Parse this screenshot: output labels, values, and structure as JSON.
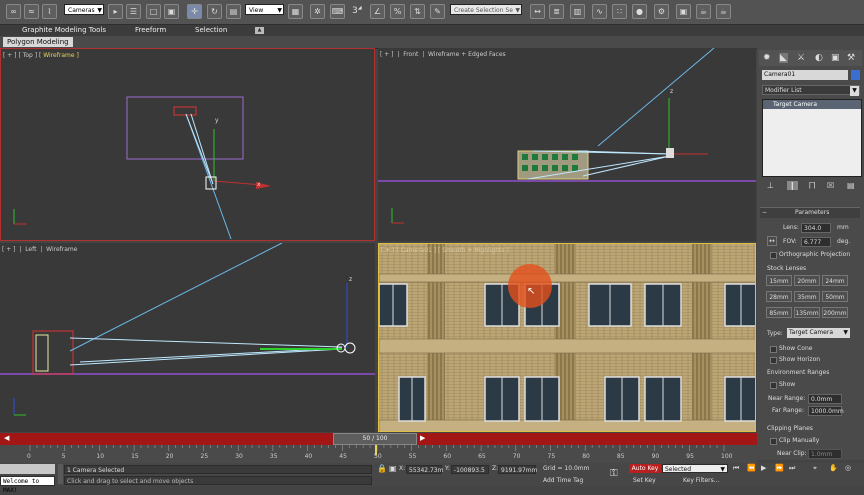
{
  "toolbar": {
    "selection_filter": "Cameras",
    "reference_coord": "View",
    "snap_number": "3",
    "named_selection_placeholder": "Create Selection Se",
    "icons": [
      "link-icon",
      "unlink-icon",
      "bind-space-warp-icon",
      "select-object-icon",
      "select-by-name-icon",
      "rectangular-selection-icon",
      "window-crossing-icon",
      "select-move-icon",
      "select-rotate-icon",
      "select-scale-icon",
      "pivot-icon",
      "select-manipulate-icon",
      "keyboard-shortcut-icon",
      "snap-toggle-icon",
      "angle-snap-icon",
      "percent-snap-icon",
      "spinner-snap-icon",
      "edit-named-selection-icon",
      "mirror-icon",
      "align-icon",
      "layer-manager-icon",
      "curve-editor-icon",
      "schematic-view-icon",
      "material-editor-icon",
      "render-setup-icon",
      "rendered-frame-icon",
      "render-icon"
    ]
  },
  "ribbon": {
    "tabs": [
      "Graphite Modeling Tools",
      "Freeform",
      "Selection"
    ],
    "active_panel": "Polygon Modeling"
  },
  "viewports": {
    "top": {
      "plus": "[ + ]",
      "view": "[ Top ]",
      "mode": "[ Wireframe ]"
    },
    "front": {
      "plus": "[ + ]",
      "view": "Front",
      "mode": "Wireframe + Edged Faces"
    },
    "left": {
      "plus": "[ + ]",
      "view": "Left",
      "mode": "Wireframe"
    },
    "camera": {
      "label": "[ + ] [ Camera01 ] [ Smooth + Highlights ]"
    }
  },
  "axis": {
    "x": "x",
    "y": "y",
    "z": "z"
  },
  "command_panel": {
    "object_name": "Camera01",
    "object_color": "#3a6fd0",
    "modifier_list": "Modifier List",
    "stack_item": "Target Camera",
    "parameters_title": "Parameters",
    "lens_label": "Lens:",
    "lens_value": "304.0",
    "lens_unit": "mm",
    "fov_label": "FOV:",
    "fov_value": "6.777",
    "fov_unit": "deg.",
    "ortho_label": "Orthographic Projection",
    "stock_lenses_title": "Stock Lenses",
    "lenses": [
      "15mm",
      "20mm",
      "24mm",
      "28mm",
      "35mm",
      "50mm",
      "85mm",
      "135mm",
      "200mm"
    ],
    "type_label": "Type:",
    "type_value": "Target Camera",
    "show_cone": "Show Cone",
    "show_horizon": "Show Horizon",
    "env_ranges_title": "Environment Ranges",
    "env_show": "Show",
    "near_range_label": "Near Range:",
    "near_range_value": "0.0mm",
    "far_range_label": "Far Range:",
    "far_range_value": "1000.0mm",
    "clip_planes_title": "Clipping Planes",
    "clip_manually": "Clip Manually",
    "near_clip_label": "Near Clip:",
    "near_clip_value": "1.0mm"
  },
  "timeline": {
    "frame_counter": "50 / 100",
    "ticks": [
      "0",
      "5",
      "10",
      "15",
      "20",
      "25",
      "30",
      "35",
      "40",
      "45",
      "50",
      "55",
      "60",
      "65",
      "70",
      "75",
      "80",
      "85",
      "90",
      "95",
      "100"
    ],
    "current_frame": 50,
    "total_frames": 100
  },
  "status": {
    "maxscript": "Welcome to MAX!",
    "selection": "1 Camera Selected",
    "prompt": "Click and drag to select and move objects",
    "x_label": "X:",
    "x_value": "55342.73m",
    "y_label": "Y:",
    "y_value": "-100893.5",
    "z_label": "Z:",
    "z_value": "9191.97mm",
    "grid": "Grid = 10.0mm",
    "add_time_tag": "Add Time Tag",
    "auto_key": "Auto Key",
    "set_key": "Set Key",
    "selected_dropdown": "Selected",
    "key_filters": "Key Filters..."
  }
}
